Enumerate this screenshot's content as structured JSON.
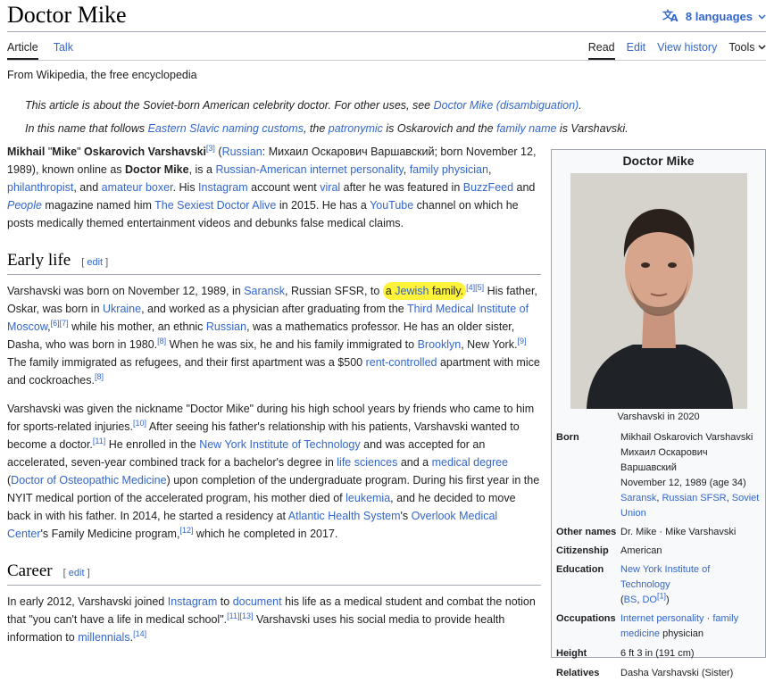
{
  "header": {
    "title": "Doctor Mike",
    "languages_label": "8 languages"
  },
  "tabs": {
    "article": "Article",
    "talk": "Talk",
    "read": "Read",
    "edit": "Edit",
    "view_history": "View history",
    "tools": "Tools"
  },
  "tagline": "From Wikipedia, the free encyclopedia",
  "hatnote1": {
    "pre": "This article is about the Soviet-born American celebrity doctor. For other uses, see ",
    "link": "Doctor Mike (disambiguation)",
    "post": "."
  },
  "hatnote2": {
    "pre": "In this name that follows ",
    "link1": "Eastern Slavic naming customs",
    "mid1": ", the ",
    "link2": "patronymic",
    "mid2": " is Oskarovich and the ",
    "link3": "family name",
    "mid3": " is Varshavski."
  },
  "intro": {
    "t1": "Mikhail",
    "t2": " \"",
    "t3": "Mike",
    "t4": "\" ",
    "t5": "Oskarovich Varshavski",
    "ref1": "[3]",
    "t6": " (",
    "l_russian": "Russian",
    "t7": ": Михаил Оскарович Варшавский; born November 12, 1989), known online as ",
    "t8": "Doctor Mike",
    "t9": ", is a ",
    "l_ra": "Russian-American",
    "t10": " ",
    "l_ip": "internet personality",
    "t11": ", ",
    "l_fp": "family physician",
    "t12": ", ",
    "l_phil": "philanthropist",
    "t13": ", and ",
    "l_ab": "amateur boxer",
    "t14": ". His ",
    "l_insta": "Instagram",
    "t15": " account went ",
    "l_viral": "viral",
    "t16": " after he was featured in ",
    "l_bf": "BuzzFeed",
    "t17": " and ",
    "l_people": "People",
    "t18": " magazine named him ",
    "l_sexiest": "The Sexiest Doctor Alive",
    "t19": " in 2015. He has a ",
    "l_yt": "YouTube",
    "t20": " channel on which he posts medically themed entertainment videos and debunks false medical claims."
  },
  "early_life": {
    "heading": "Early life",
    "edit_open": "[",
    "edit": "edit",
    "edit_close": "]",
    "p1": {
      "t1": "Varshavski was born on November 12, 1989, in ",
      "l_saransk": "Saransk",
      "t2": ", Russian SFSR, to ",
      "t_a": "a ",
      "l_jewish": "Jewish",
      "t_family": " family.",
      "ref45": "[4][5]",
      "t3": " His father, Oskar, was born in ",
      "l_ukraine": "Ukraine",
      "t4": ", and worked as a physician after graduating from the ",
      "l_third": "Third Medical Institute of Moscow",
      "t5": ",",
      "ref67": "[6][7]",
      "t6": " while his mother, an ethnic ",
      "l_russian": "Russian",
      "t7": ", was a mathematics professor. He has an older sister, Dasha, who was born in 1980.",
      "ref8": "[8]",
      "t8": " When he was six, he and his family immigrated to ",
      "l_brooklyn": "Brooklyn",
      "t9": ", New York.",
      "ref9": "[9]",
      "t10": " The family immigrated as refugees, and their first apartment was a $500 ",
      "l_rent": "rent-controlled",
      "t11": " apartment with mice and cockroaches.",
      "ref8b": "[8]"
    },
    "p2": {
      "t1": "Varshavski was given the nickname \"Doctor Mike\" during his high school years by friends who came to him for sports-related injuries.",
      "ref10": "[10]",
      "t2": " After seeing his father's relationship with his patients, Varshavski wanted to become a doctor.",
      "ref11": "[11]",
      "t3": " He enrolled in the ",
      "l_nyit": "New York Institute of Technology",
      "t4": " and was accepted for an accelerated, seven-year combined track for a bachelor's degree in ",
      "l_life": "life sciences",
      "t5": " and a ",
      "l_md": "medical degree",
      "t6": " (",
      "l_do": "Doctor of Osteopathic Medicine",
      "t7": ") upon completion of the undergraduate program. During his first year in the NYIT medical portion of the accelerated program, his mother died of ",
      "l_leuk": "leukemia",
      "t8": ", and he decided to move back in with his father. In 2014, he started a residency at ",
      "l_ahs": "Atlantic Health System",
      "t9": "'s ",
      "l_omc": "Overlook Medical Center",
      "t10": "'s Family Medicine program,",
      "ref12": "[12]",
      "t11": " which he completed in 2017."
    }
  },
  "career": {
    "heading": "Career",
    "edit_open": "[",
    "edit": "edit",
    "edit_close": "]",
    "p1": {
      "t1": "In early 2012, Varshavski joined ",
      "l_insta": "Instagram",
      "t2": " to ",
      "l_doc": "document",
      "t3": " his life as a medical student and combat the notion that \"you can't have a life in medical school\".",
      "ref1113": "[11][13]",
      "t4": " Varshavski uses his social media to provide health information to ",
      "l_mill": "millennials",
      "t5": ".",
      "ref14": "[14]"
    }
  },
  "infobox": {
    "title": "Doctor Mike",
    "caption": "Varshavski in 2020",
    "born_label": "Born",
    "born_name": "Mikhail Oskarovich Varshavski",
    "born_cyr": "Михаил Оскарович Варшавский",
    "born_date": "November 12, 1989 (age 34)",
    "born_place1": "Saransk",
    "born_sep1": ", ",
    "born_place2": "Russian SFSR",
    "born_sep2": ", ",
    "born_place3": "Soviet Union",
    "other_label": "Other names",
    "other_val": "Dr. Mike · Mike Varshavski",
    "cit_label": "Citizenship",
    "cit_val": "American",
    "edu_label": "Education",
    "edu_school": "New York Institute of Technology",
    "edu_open": "(",
    "edu_bs": "BS",
    "edu_sep": ", ",
    "edu_do": "DO",
    "edu_ref": "[1]",
    "edu_close": ")",
    "occ_label": "Occupations",
    "occ_1": "Internet personality",
    "occ_dot": " · ",
    "occ_2": "family medicine",
    "occ_3": " physician",
    "height_label": "Height",
    "height_val": "6 ft 3 in (191 cm)",
    "rel_label": "Relatives",
    "rel_val": "Dasha Varshavski (Sister)"
  }
}
